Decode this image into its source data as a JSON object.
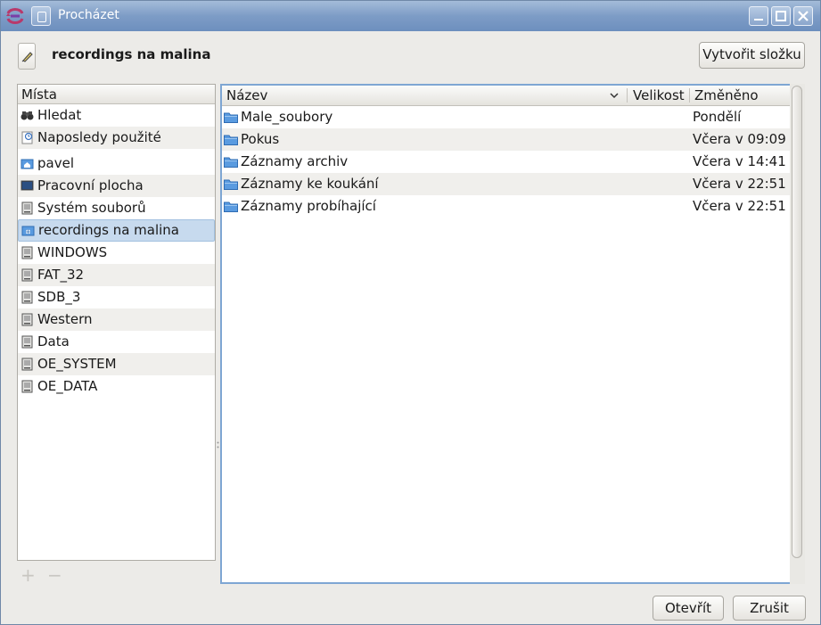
{
  "window": {
    "title": "Procházet"
  },
  "header": {
    "title": "recordings na malina",
    "new_folder_label": "Vytvořit složku"
  },
  "places": {
    "column_header": "Místa",
    "items": [
      {
        "label": "Hledat",
        "icon": "binoculars-icon"
      },
      {
        "label": "Naposledy použité",
        "icon": "recent-documents-icon"
      },
      {
        "label": "pavel",
        "icon": "home-folder-icon"
      },
      {
        "label": "Pracovní plocha",
        "icon": "desktop-icon"
      },
      {
        "label": "Systém souborů",
        "icon": "drive-icon"
      },
      {
        "label": "recordings na malina",
        "icon": "network-folder-icon",
        "selected": true
      },
      {
        "label": "WINDOWS",
        "icon": "drive-icon"
      },
      {
        "label": "FAT_32",
        "icon": "drive-icon"
      },
      {
        "label": "SDB_3",
        "icon": "drive-icon"
      },
      {
        "label": "Western",
        "icon": "drive-icon"
      },
      {
        "label": "Data",
        "icon": "drive-icon"
      },
      {
        "label": "OE_SYSTEM",
        "icon": "drive-icon"
      },
      {
        "label": "OE_DATA",
        "icon": "drive-icon"
      }
    ],
    "add_label": "+",
    "remove_label": "−"
  },
  "files": {
    "columns": {
      "name": "Název",
      "size": "Velikost",
      "modified": "Změněno"
    },
    "rows": [
      {
        "name": "Male_soubory",
        "size": "",
        "modified": "Pondělí"
      },
      {
        "name": "Pokus",
        "size": "",
        "modified": "Včera v 09:09"
      },
      {
        "name": "Záznamy archiv",
        "size": "",
        "modified": "Včera v 14:41"
      },
      {
        "name": "Záznamy ke koukání",
        "size": "",
        "modified": "Včera v 22:51"
      },
      {
        "name": "Záznamy probíhající",
        "size": "",
        "modified": "Včera v 22:51"
      }
    ]
  },
  "footer": {
    "open_label": "Otevřít",
    "cancel_label": "Zrušit"
  },
  "colors": {
    "titlebar": "#7d9cc6",
    "selection": "#c7daee",
    "focus_border": "#7ea6d3",
    "folder": "#4f8fd6"
  }
}
